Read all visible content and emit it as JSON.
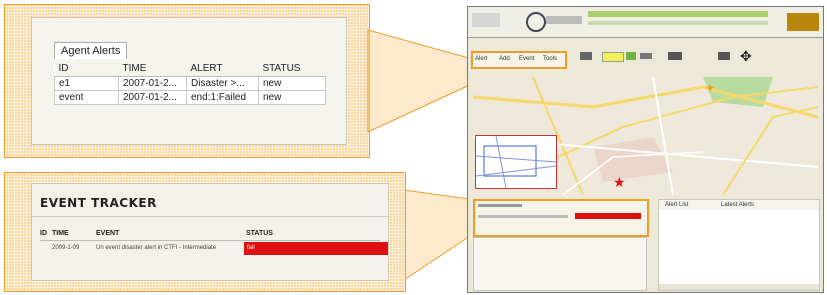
{
  "agent_alerts": {
    "tab_label": "Agent Alerts",
    "columns": [
      "ID",
      "TIME",
      "ALERT",
      "STATUS"
    ],
    "rows": [
      [
        "e1",
        "2007-01-2...",
        "Disaster >...",
        "new"
      ],
      [
        "event",
        "2007-01-2...",
        "end:1:Failed",
        "new"
      ]
    ]
  },
  "event_tracker": {
    "title": "EVENT TRACKER",
    "columns": [
      "ID",
      "TIME",
      "EVENT",
      "STATUS"
    ],
    "row": {
      "id": "",
      "time": "2009-1-09",
      "event": "Un event disaster alert in CTFI - Intermediate",
      "status": "fail"
    }
  },
  "screenshot": {
    "mini_tabs": [
      "Alert",
      "Add",
      "Event",
      "Tools"
    ],
    "panel_tabs": [
      "Alert List",
      "Latest Alerts"
    ],
    "colors": {
      "accent": "#f09a2a",
      "status_fail": "#dd1111",
      "map_road": "#f5d86a",
      "park": "#b8dba0"
    }
  }
}
